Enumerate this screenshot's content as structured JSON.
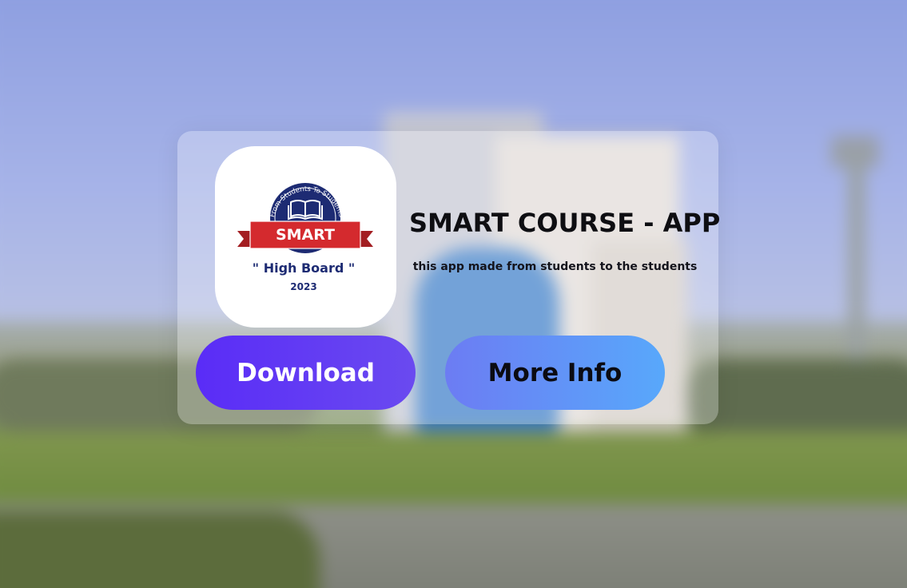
{
  "app": {
    "title": "SMART COURSE - APP",
    "subtitle": "this app made from students to the students"
  },
  "logo": {
    "arc_text": "From Students To Students",
    "banner_text": "SMART",
    "tagline": "\" High Board \"",
    "year": "2023",
    "icon": "open-book-icon"
  },
  "buttons": {
    "download_label": "Download",
    "more_info_label": "More Info"
  },
  "colors": {
    "download_gradient": [
      "#5a2cf7",
      "#6a4af0"
    ],
    "info_gradient": [
      "#6c7cf3",
      "#58a8fb"
    ],
    "banner_red": "#d42a2e",
    "badge_navy": "#1d2b73"
  }
}
